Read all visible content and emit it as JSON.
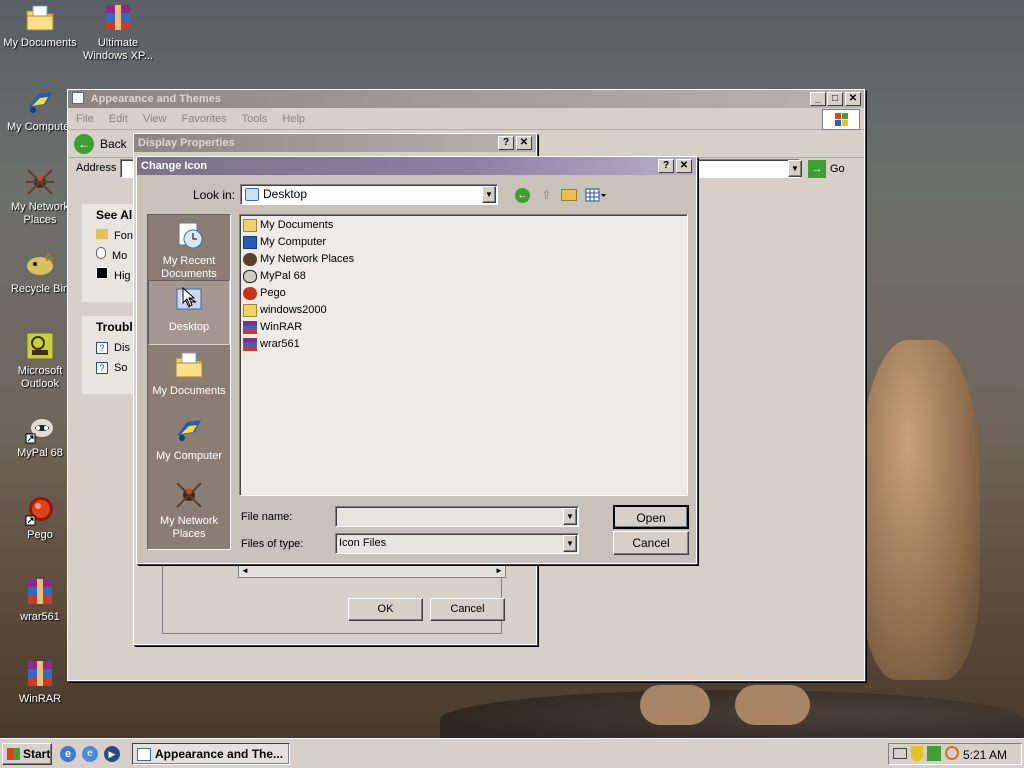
{
  "desktop": {
    "icons": [
      {
        "label": "My Documents",
        "icon": "folder-documents-icon"
      },
      {
        "label": "Ultimate Windows XP...",
        "icon": "winrar-icon"
      },
      {
        "label": "My Computer",
        "icon": "computer-icon"
      },
      {
        "label": "My Network Places",
        "icon": "network-icon"
      },
      {
        "label": "Recycle Bin",
        "icon": "recycle-bin-icon"
      },
      {
        "label": "Microsoft Outlook",
        "icon": "outlook-icon"
      },
      {
        "label": "MyPal 68",
        "icon": "mypal-icon"
      },
      {
        "label": "Pego",
        "icon": "pego-icon"
      },
      {
        "label": "wrar561",
        "icon": "winrar-icon"
      },
      {
        "label": "WinRAR",
        "icon": "winrar-icon"
      }
    ]
  },
  "explorer": {
    "title": "Appearance and Themes",
    "menu": [
      "File",
      "Edit",
      "View",
      "Favorites",
      "Tools",
      "Help"
    ],
    "back_label": "Back",
    "address_label": "Address",
    "go_label": "Go",
    "see_also_title": "See Al",
    "see_also_items": [
      "Fon",
      "Mo",
      "Hig"
    ],
    "troubleshoot_title": "Troubl",
    "troubleshoot_items": [
      "Dis",
      "So"
    ]
  },
  "display_properties": {
    "title": "Display Properties",
    "ok_label": "OK",
    "cancel_label": "Cancel"
  },
  "change_icon": {
    "title": "Change Icon",
    "look_in_label": "Look in:",
    "look_in_value": "Desktop",
    "places": [
      "My Recent Documents",
      "Desktop",
      "My Documents",
      "My Computer",
      "My Network Places"
    ],
    "files": [
      {
        "name": "My Documents",
        "icon": "folder-documents-icon"
      },
      {
        "name": "My Computer",
        "icon": "computer-icon"
      },
      {
        "name": "My Network Places",
        "icon": "network-icon"
      },
      {
        "name": "MyPal 68",
        "icon": "mypal-icon"
      },
      {
        "name": "Pego",
        "icon": "pego-icon"
      },
      {
        "name": "windows2000",
        "icon": "folder-icon"
      },
      {
        "name": "WinRAR",
        "icon": "winrar-icon"
      },
      {
        "name": "wrar561",
        "icon": "winrar-icon"
      }
    ],
    "file_name_label": "File name:",
    "file_name_value": "",
    "files_of_type_label": "Files of type:",
    "files_of_type_value": "Icon Files",
    "open_label": "Open",
    "cancel_label": "Cancel"
  },
  "taskbar": {
    "start_label": "Start",
    "task_label": "Appearance and The...",
    "clock": "5:21 AM"
  }
}
